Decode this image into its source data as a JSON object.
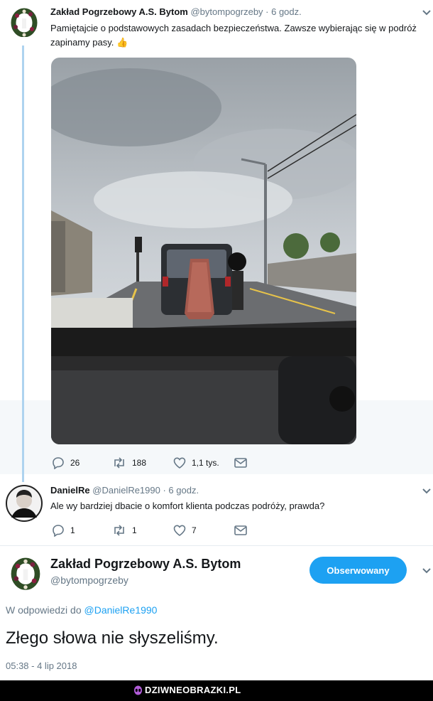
{
  "tweet1": {
    "name": "Zakład Pogrzebowy A.S. Bytom",
    "handle": "@bytompogrzeby",
    "time": "· 6 godz.",
    "text": "Pamiętajcie o podstawowych zasadach bezpieczeństwa. Zawsze wybierając się w podróż zapinamy pasy.",
    "emoji": "👍",
    "replies": "26",
    "retweets": "188",
    "likes": "1,1 tys."
  },
  "tweet2": {
    "name": "DanielRe",
    "handle": "@DanielRe1990",
    "time": "· 6 godz.",
    "text": "Ale wy bardziej dbacie o komfort klienta podczas podróży, prawda?",
    "replies": "1",
    "retweets": "1",
    "likes": "7"
  },
  "main": {
    "name": "Zakład Pogrzebowy A.S. Bytom",
    "handle": "@bytompogrzeby",
    "follow_label": "Obserwowany",
    "reply_prefix": "W odpowiedzi do",
    "reply_to": "@DanielRe1990",
    "text": "Złego słowa nie słyszeliśmy.",
    "timestamp": "05:38 - 4 lip 2018"
  },
  "watermark": "DZIWNEOBRAZKI.PL",
  "colors": {
    "accent": "#1da1f2",
    "thread_line": "#aed3ef",
    "muted": "#657786"
  }
}
